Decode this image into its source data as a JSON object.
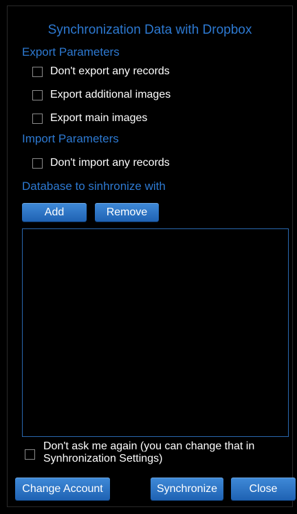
{
  "dialog": {
    "title": "Synchronization Data with Dropbox"
  },
  "export": {
    "heading": "Export Parameters",
    "options": [
      {
        "label": "Don't export any records",
        "checked": false
      },
      {
        "label": "Export additional images",
        "checked": false
      },
      {
        "label": "Export main images",
        "checked": false
      }
    ]
  },
  "import": {
    "heading": "Import Parameters",
    "options": [
      {
        "label": "Don't import any records",
        "checked": false
      }
    ]
  },
  "database": {
    "heading": "Database to sinhronize with",
    "add_label": "Add",
    "remove_label": "Remove",
    "items": []
  },
  "ask_again": {
    "line1": "Don't ask me again (you can change that in",
    "line2": "Synhronization Settings)",
    "checked": false
  },
  "footer": {
    "change_account_label": "Change Account",
    "synchronize_label": "Synchronize",
    "close_label": "Close"
  },
  "colors": {
    "accent": "#2d79d1",
    "button_top": "#3f8ad8",
    "button_bottom": "#1f62b3",
    "background": "#000000"
  }
}
